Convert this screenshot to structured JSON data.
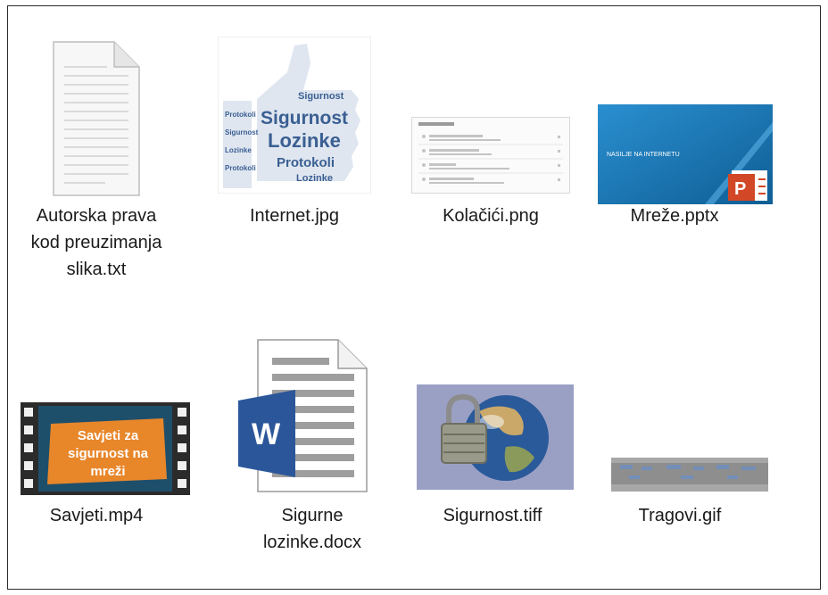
{
  "files": [
    {
      "name": "Autorska prava kod preuzimanja slika.txt",
      "lines": [
        "Autorska prava",
        "kod preuzimanja",
        "slika.txt"
      ],
      "icon": "text-file-icon"
    },
    {
      "name": "Internet.jpg",
      "lines": [
        "Internet.jpg"
      ],
      "icon": "image-thumbnail",
      "thumb_text": {
        "w1": "Sigurnost",
        "w2": "Lozinke",
        "w3": "Protokoli",
        "w4": "Lozinke",
        "w5": "Sigurnost",
        "w6": "Protokoli"
      }
    },
    {
      "name": "Kolačići.png",
      "lines": [
        "Kolačići.png"
      ],
      "icon": "image-thumbnail"
    },
    {
      "name": "Mreže.pptx",
      "lines": [
        "Mreže.pptx"
      ],
      "icon": "powerpoint-thumbnail",
      "thumb_text": {
        "slide_title": "NASILJE NA INTERNETU",
        "badge": "P"
      }
    },
    {
      "name": "Savjeti.mp4",
      "lines": [
        "Savjeti.mp4"
      ],
      "icon": "video-thumbnail",
      "thumb_text": {
        "l1": "Savjeti za",
        "l2": "sigurnost na",
        "l3": "mreži"
      }
    },
    {
      "name": "Sigurne lozinke.docx",
      "lines": [
        "Sigurne",
        "lozinke.docx"
      ],
      "icon": "word-file-icon",
      "thumb_text": {
        "badge": "W"
      }
    },
    {
      "name": "Sigurnost.tiff",
      "lines": [
        "Sigurnost.tiff"
      ],
      "icon": "image-thumbnail"
    },
    {
      "name": "Tragovi.gif",
      "lines": [
        "Tragovi.gif"
      ],
      "icon": "image-thumbnail"
    }
  ],
  "colors": {
    "word_blue": "#2b579a",
    "ppt_orange": "#d24726",
    "video_orange": "#e8862a",
    "slide_blue": "#1f7fbf"
  }
}
